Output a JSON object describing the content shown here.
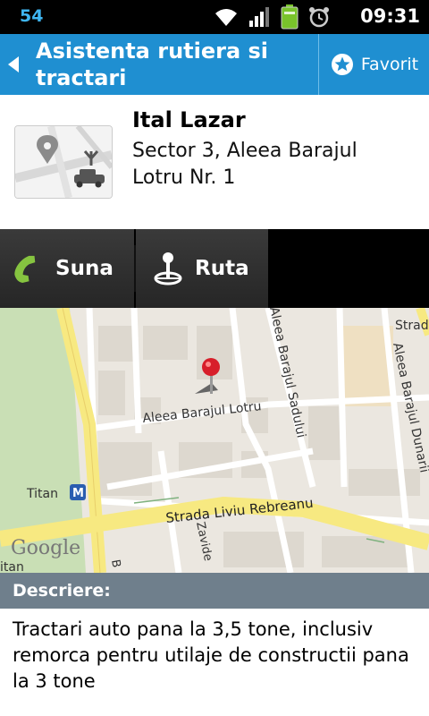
{
  "status_bar": {
    "notification_count": "54",
    "time": "09:31",
    "icons": [
      "wifi-icon",
      "signal-icon",
      "battery-icon",
      "alarm-icon"
    ],
    "colors": {
      "background": "#000000",
      "count": "#3fb6f2"
    }
  },
  "header": {
    "title": "Asistenta rutiera si tractari",
    "favorite_label": "Favorit",
    "colors": {
      "background": "#1f8fd1"
    }
  },
  "listing": {
    "name": "Ital Lazar",
    "address": "Sector 3, Aleea Barajul Lotru Nr. 1"
  },
  "actions": {
    "call_label": "Suna",
    "route_label": "Ruta",
    "colors": {
      "call_icon": "#86c440"
    }
  },
  "map": {
    "street_labels": {
      "aleea_lotru": "Aleea Barajul Lotru",
      "sadului": "Aleea Barajul Sadului",
      "dunarii": "Aleea Barajul Dunarii",
      "rebreanu": "Strada Liviu Rebreanu",
      "strada": "Strad",
      "zavid": "Zavide",
      "b": "B"
    },
    "station_label": "Titan",
    "station_label_bottom": "itan",
    "metro_symbol": "M",
    "logo_text": "Google"
  },
  "description": {
    "heading": "Descriere:",
    "text": "Tractari auto pana la 3,5 tone, inclusiv remorca pentru utilaje de constructii pana la 3 tone",
    "colors": {
      "heading_background": "#6f7f8c"
    }
  }
}
